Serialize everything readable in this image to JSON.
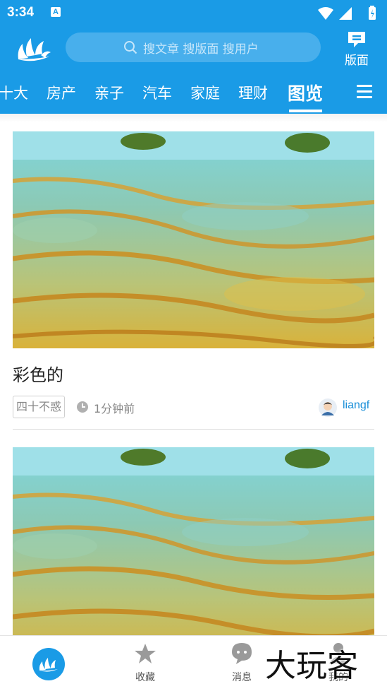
{
  "status": {
    "time": "3:34",
    "notif_badge": "A"
  },
  "search": {
    "placeholder": "搜文章 搜版面 搜用户"
  },
  "header": {
    "bankuai_label": "版面"
  },
  "tabs": [
    {
      "label": "十大"
    },
    {
      "label": "房产"
    },
    {
      "label": "亲子"
    },
    {
      "label": "汽车"
    },
    {
      "label": "家庭"
    },
    {
      "label": "理财"
    },
    {
      "label": "图览",
      "active": true
    }
  ],
  "posts": [
    {
      "title": "彩色的",
      "tag": "四十不惑",
      "time": "1分钟前",
      "author": "liangf"
    }
  ],
  "bottom_nav": [
    {
      "label": ""
    },
    {
      "label": "收藏"
    },
    {
      "label": "消息"
    },
    {
      "label": "我的"
    }
  ],
  "watermark": "大玩客",
  "colors": {
    "brand": "#1a9be6",
    "author": "#1a8fd8"
  }
}
